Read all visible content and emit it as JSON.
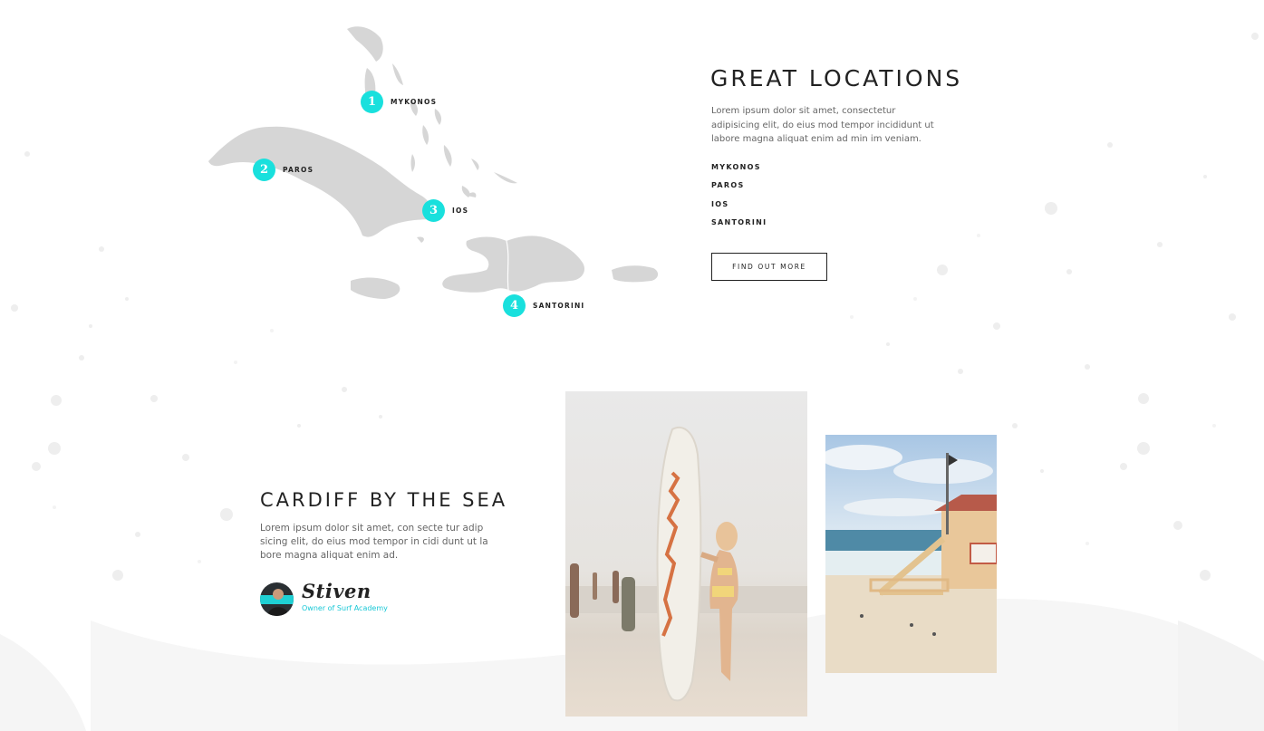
{
  "colors": {
    "accent": "#19e0dd",
    "text": "#222222",
    "muted": "#666666",
    "map_land": "#d6d6d6"
  },
  "map": {
    "markers": [
      {
        "number": "1",
        "label": "MYKONOS"
      },
      {
        "number": "2",
        "label": "PAROS"
      },
      {
        "number": "3",
        "label": "IOS"
      },
      {
        "number": "4",
        "label": "SANTORINI"
      }
    ]
  },
  "locations": {
    "title": "GREAT LOCATIONS",
    "text": "Lorem ipsum dolor sit amet, consectetur adipisicing elit, do eius mod tempor incididunt ut labore magna aliquat enim ad min im veniam.",
    "items": [
      "MYKONOS",
      "PAROS",
      "IOS",
      "SANTORINI"
    ],
    "button_label": "FIND OUT MORE"
  },
  "cardiff": {
    "title": "CARDIFF BY THE SEA",
    "text": "Lorem ipsum dolor sit amet, con secte tur adip sicing elit, do eius mod tempor in cidi dunt ut la bore magna aliquat enim ad.",
    "signature": "Stiven",
    "owner": "Owner of Surf Academy"
  }
}
